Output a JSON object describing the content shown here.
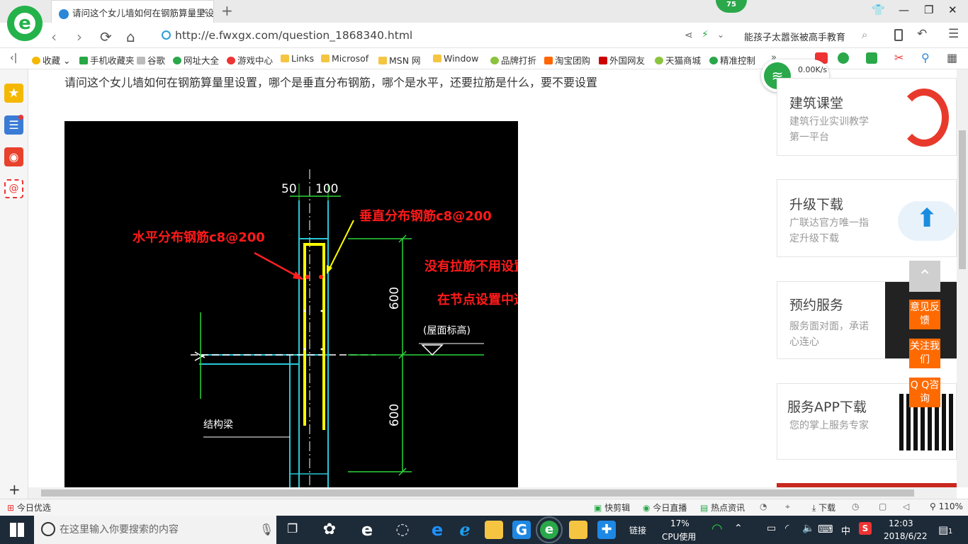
{
  "browser": {
    "tab_title": "请问这个女儿墙如何在钢筋算量里设",
    "tab_close": "×",
    "new_tab": "+",
    "badge": "75",
    "url": "http://e.fwxgx.com/question_1868340.html",
    "search_text": "能孩子太嚣张被高手教育"
  },
  "bookmarks": [
    {
      "label": "收藏",
      "color": "#f5b800"
    },
    {
      "label": "手机收藏夹",
      "color": "#27a845"
    },
    {
      "label": "谷歌",
      "color": "#bbbbbb"
    },
    {
      "label": "网址大全",
      "color": "#2aa84a"
    },
    {
      "label": "游戏中心",
      "color": "#e33"
    },
    {
      "label": "Links",
      "color": "#f5c542"
    },
    {
      "label": "Microsof",
      "color": "#f5c542"
    },
    {
      "label": "MSN 网",
      "color": "#f5c542"
    },
    {
      "label": "Window",
      "color": "#f5c542"
    },
    {
      "label": "品牌打折",
      "color": "#8ac43f"
    },
    {
      "label": "淘宝团购",
      "color": "#ff6600"
    },
    {
      "label": "外国网友",
      "color": "#c00"
    },
    {
      "label": "天猫商城",
      "color": "#8ac43f"
    },
    {
      "label": "精准控制",
      "color": "#2aa84a"
    }
  ],
  "net_widget": {
    "speed": "0.00K/s",
    "count": "0"
  },
  "question": "请问这个女儿墙如何在钢筋算量里设置，哪个是垂直分布钢筋，哪个是水平，还要拉筋是什么，要不要设置",
  "drawing": {
    "dim_50": "50",
    "dim_100": "100",
    "dim_600_top": "600",
    "dim_600_bottom": "600",
    "roof_elevation": "(屋面标高)",
    "structural_beam": "结构梁",
    "annot_horizontal": "水平分布钢筋c8@200",
    "annot_vertical": "垂直分布钢筋c8@200",
    "annot_no_tie": "没有拉筋不用设置",
    "annot_anchor": "在节点设置中选择锚固梁Lae"
  },
  "sidebar_cards": [
    {
      "title": "建筑课堂",
      "subtitle": "建筑行业实训教学第一平台"
    },
    {
      "title": "升级下载",
      "subtitle": "广联达官方唯一指定升级下载"
    },
    {
      "title": "预约服务",
      "subtitle": "服务面对面，承诺心连心"
    },
    {
      "title": "服务APP下载",
      "subtitle": "您的掌上服务专家"
    }
  ],
  "float_buttons": {
    "feedback": "意见反馈",
    "follow": "关注我们",
    "qq": "Q Q咨询"
  },
  "statusbar": {
    "left": "今日优选",
    "items": [
      "快剪辑",
      "今日直播",
      "热点资讯"
    ],
    "download": "下载",
    "zoom": "110%"
  },
  "taskbar": {
    "search_placeholder": "在这里输入你要搜索的内容",
    "link": "链接",
    "cpu_percent": "17%",
    "cpu_label": "CPU使用",
    "ime": "中",
    "time": "12:03",
    "date": "2018/6/22",
    "notifications": "1"
  }
}
